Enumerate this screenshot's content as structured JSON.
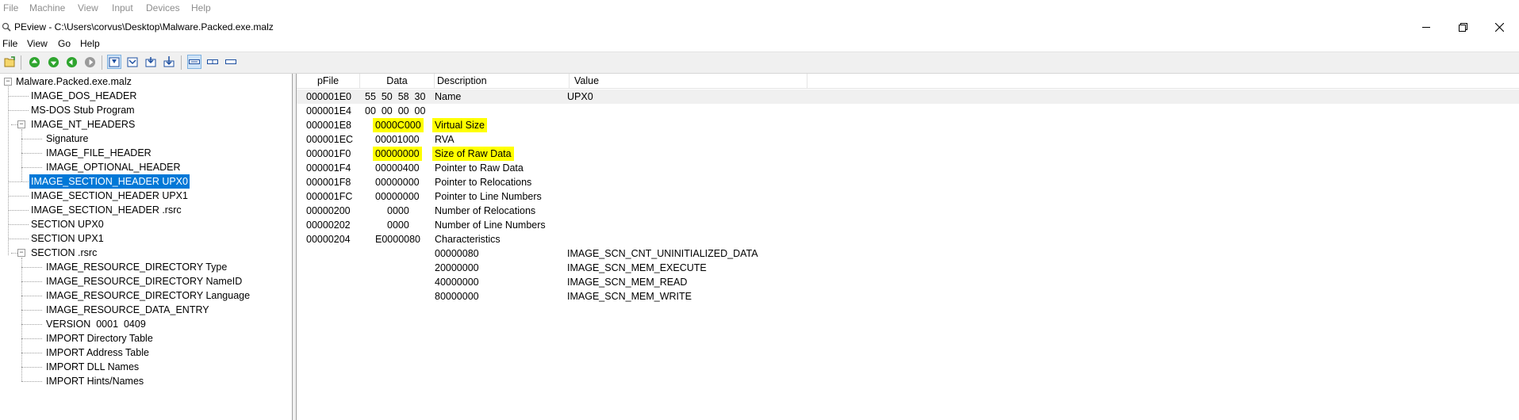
{
  "vm_menu": [
    "File",
    "Machine",
    "View",
    "Input",
    "Devices",
    "Help"
  ],
  "window": {
    "title": "PEview - C:\\Users\\corvus\\Desktop\\Malware.Packed.exe.malz",
    "minimize": "—",
    "maximize": "❐",
    "close": "✕"
  },
  "app_menu": [
    "File",
    "View",
    "Go",
    "Help"
  ],
  "toolbar_icons": [
    "open-folder-icon",
    "go-up-icon",
    "go-down-icon",
    "back-icon",
    "forward-icon",
    "view-byte-icon",
    "view-word-icon",
    "view-dword-icon",
    "view-qword-icon",
    "view-details-icon",
    "view-hex-icon",
    "view-text-icon"
  ],
  "tree": {
    "root": "Malware.Packed.exe.malz",
    "items": [
      "IMAGE_DOS_HEADER",
      "MS-DOS Stub Program",
      "IMAGE_NT_HEADERS",
      "Signature",
      "IMAGE_FILE_HEADER",
      "IMAGE_OPTIONAL_HEADER",
      "IMAGE_SECTION_HEADER UPX0",
      "IMAGE_SECTION_HEADER UPX1",
      "IMAGE_SECTION_HEADER .rsrc",
      "SECTION UPX0",
      "SECTION UPX1",
      "SECTION .rsrc",
      "IMAGE_RESOURCE_DIRECTORY Type",
      "IMAGE_RESOURCE_DIRECTORY NameID",
      "IMAGE_RESOURCE_DIRECTORY Language",
      "IMAGE_RESOURCE_DATA_ENTRY",
      "VERSION  0001  0409",
      "IMPORT Directory Table",
      "IMPORT Address Table",
      "IMPORT DLL Names",
      "IMPORT Hints/Names"
    ],
    "selected": "IMAGE_SECTION_HEADER UPX0"
  },
  "columns": [
    "pFile",
    "Data",
    "Description",
    "Value"
  ],
  "rows": [
    {
      "pfile": "000001E0",
      "data": "55  50  58  30",
      "desc": "Name",
      "value": "UPX0",
      "highlight": false
    },
    {
      "pfile": "000001E4",
      "data": "00  00  00  00",
      "desc": "",
      "value": "",
      "highlight": false
    },
    {
      "pfile": "000001E8",
      "data": "0000C000",
      "desc": "Virtual Size",
      "value": "",
      "highlight": true
    },
    {
      "pfile": "000001EC",
      "data": "00001000",
      "desc": "RVA",
      "value": "",
      "highlight": false
    },
    {
      "pfile": "000001F0",
      "data": "00000000",
      "desc": "Size of Raw Data",
      "value": "",
      "highlight": true
    },
    {
      "pfile": "000001F4",
      "data": "00000400",
      "desc": "Pointer to Raw Data",
      "value": "",
      "highlight": false
    },
    {
      "pfile": "000001F8",
      "data": "00000000",
      "desc": "Pointer to Relocations",
      "value": "",
      "highlight": false
    },
    {
      "pfile": "000001FC",
      "data": "00000000",
      "desc": "Pointer to Line Numbers",
      "value": "",
      "highlight": false
    },
    {
      "pfile": "00000200",
      "data": "0000",
      "desc": "Number of Relocations",
      "value": "",
      "highlight": false
    },
    {
      "pfile": "00000202",
      "data": "0000",
      "desc": "Number of Line Numbers",
      "value": "",
      "highlight": false
    },
    {
      "pfile": "00000204",
      "data": "E0000080",
      "desc": "Characteristics",
      "value": "",
      "highlight": false
    },
    {
      "pfile": "",
      "data": "",
      "desc": "00000080",
      "value": "IMAGE_SCN_CNT_UNINITIALIZED_DATA",
      "highlight": false
    },
    {
      "pfile": "",
      "data": "",
      "desc": "20000000",
      "value": "IMAGE_SCN_MEM_EXECUTE",
      "highlight": false
    },
    {
      "pfile": "",
      "data": "",
      "desc": "40000000",
      "value": "IMAGE_SCN_MEM_READ",
      "highlight": false
    },
    {
      "pfile": "",
      "data": "",
      "desc": "80000000",
      "value": "IMAGE_SCN_MEM_WRITE",
      "highlight": false
    }
  ],
  "colors": {
    "selection": "#0078d7",
    "highlight": "#ffff00",
    "accent": "#1e8e3e"
  }
}
